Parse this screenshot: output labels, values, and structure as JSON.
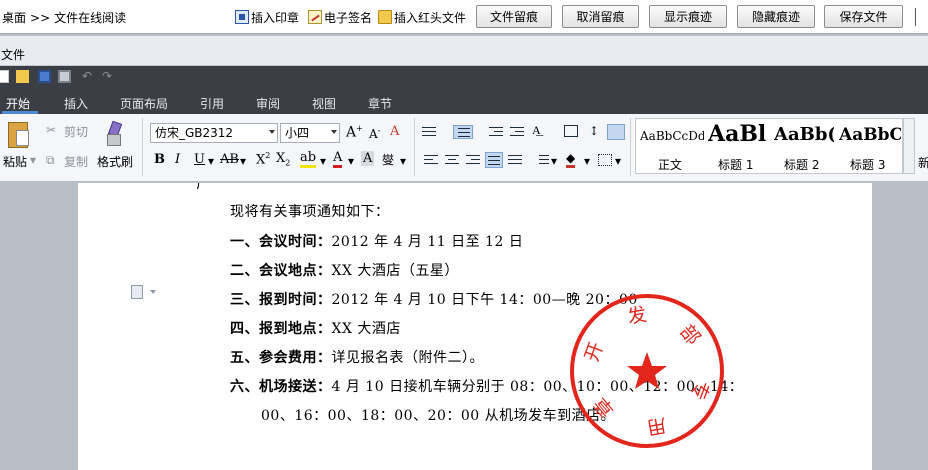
{
  "topbar": {
    "breadcrumb_home": "桌面",
    "breadcrumb_sep": ">>",
    "breadcrumb_current": "文件在线阅读",
    "tools": {
      "insert_stamp": "插入印章",
      "e_sign": "电子签名",
      "insert_red_header": "插入红头文件"
    },
    "buttons": {
      "track_changes": "文件留痕",
      "cancel_track": "取消留痕",
      "show_marks": "显示痕迹",
      "hide_marks": "隐藏痕迹",
      "save_file": "保存文件"
    }
  },
  "filebar": {
    "label": "文件"
  },
  "tabs": [
    "开始",
    "插入",
    "页面布局",
    "引用",
    "审阅",
    "视图",
    "章节"
  ],
  "ribbon": {
    "paste": "粘贴",
    "cut": "剪切",
    "copy": "复制",
    "format_painter": "格式刷",
    "font_name": "仿宋_GB2312",
    "font_size": "小四",
    "styles": [
      {
        "preview": "AaBbCcDd",
        "name": "正文"
      },
      {
        "preview": "AaBl",
        "name": "标题 1"
      },
      {
        "preview": "AaBb(",
        "name": "标题 2"
      },
      {
        "preview": "AaBbC",
        "name": "标题 3"
      }
    ],
    "styles_more": "新"
  },
  "document": {
    "intro": "现将有关事项通知如下：",
    "items": [
      {
        "label": "一、会议时间：",
        "value": "2012 年 4 月 11 日至 12 日"
      },
      {
        "label": "二、会议地点：",
        "value": "XX 大酒店（五星）"
      },
      {
        "label": "三、报到时间：",
        "value": "2012 年 4 月 10 日下午 14：00—晚 20：00"
      },
      {
        "label": "四、报到地点：",
        "value": "XX 大酒店"
      },
      {
        "label": "五、参会费用：",
        "value": "详见报名表（附件二）。"
      },
      {
        "label": "六、机场接送：",
        "value": "4 月 10 日接机车辆分别于 08：00、10：00、12：00、14："
      }
    ],
    "continuation": "00、16：00、18：00、20：00 从机场发车到酒店。",
    "stamp_text": "开发部专用章"
  },
  "colors": {
    "stamp_red": "#e3261c",
    "tab_bar": "#3b3f45",
    "accent": "#4e8ad3"
  }
}
